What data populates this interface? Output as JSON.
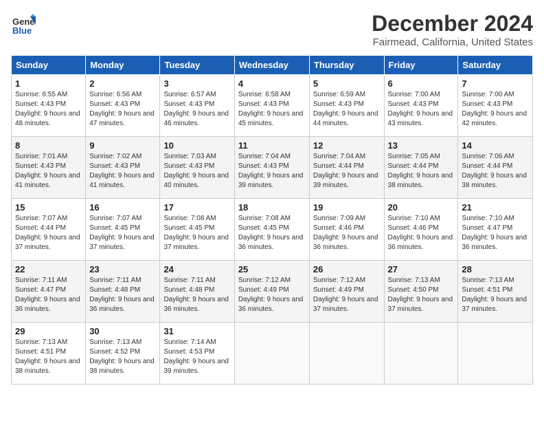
{
  "logo": {
    "line1": "General",
    "line2": "Blue"
  },
  "title": "December 2024",
  "subtitle": "Fairmead, California, United States",
  "weekdays": [
    "Sunday",
    "Monday",
    "Tuesday",
    "Wednesday",
    "Thursday",
    "Friday",
    "Saturday"
  ],
  "weeks": [
    [
      {
        "day": "1",
        "sunrise": "6:55 AM",
        "sunset": "4:43 PM",
        "daylight": "9 hours and 48 minutes."
      },
      {
        "day": "2",
        "sunrise": "6:56 AM",
        "sunset": "4:43 PM",
        "daylight": "9 hours and 47 minutes."
      },
      {
        "day": "3",
        "sunrise": "6:57 AM",
        "sunset": "4:43 PM",
        "daylight": "9 hours and 46 minutes."
      },
      {
        "day": "4",
        "sunrise": "6:58 AM",
        "sunset": "4:43 PM",
        "daylight": "9 hours and 45 minutes."
      },
      {
        "day": "5",
        "sunrise": "6:59 AM",
        "sunset": "4:43 PM",
        "daylight": "9 hours and 44 minutes."
      },
      {
        "day": "6",
        "sunrise": "7:00 AM",
        "sunset": "4:43 PM",
        "daylight": "9 hours and 43 minutes."
      },
      {
        "day": "7",
        "sunrise": "7:00 AM",
        "sunset": "4:43 PM",
        "daylight": "9 hours and 42 minutes."
      }
    ],
    [
      {
        "day": "8",
        "sunrise": "7:01 AM",
        "sunset": "4:43 PM",
        "daylight": "9 hours and 41 minutes."
      },
      {
        "day": "9",
        "sunrise": "7:02 AM",
        "sunset": "4:43 PM",
        "daylight": "9 hours and 41 minutes."
      },
      {
        "day": "10",
        "sunrise": "7:03 AM",
        "sunset": "4:43 PM",
        "daylight": "9 hours and 40 minutes."
      },
      {
        "day": "11",
        "sunrise": "7:04 AM",
        "sunset": "4:43 PM",
        "daylight": "9 hours and 39 minutes."
      },
      {
        "day": "12",
        "sunrise": "7:04 AM",
        "sunset": "4:44 PM",
        "daylight": "9 hours and 39 minutes."
      },
      {
        "day": "13",
        "sunrise": "7:05 AM",
        "sunset": "4:44 PM",
        "daylight": "9 hours and 38 minutes."
      },
      {
        "day": "14",
        "sunrise": "7:06 AM",
        "sunset": "4:44 PM",
        "daylight": "9 hours and 38 minutes."
      }
    ],
    [
      {
        "day": "15",
        "sunrise": "7:07 AM",
        "sunset": "4:44 PM",
        "daylight": "9 hours and 37 minutes."
      },
      {
        "day": "16",
        "sunrise": "7:07 AM",
        "sunset": "4:45 PM",
        "daylight": "9 hours and 37 minutes."
      },
      {
        "day": "17",
        "sunrise": "7:08 AM",
        "sunset": "4:45 PM",
        "daylight": "9 hours and 37 minutes."
      },
      {
        "day": "18",
        "sunrise": "7:08 AM",
        "sunset": "4:45 PM",
        "daylight": "9 hours and 36 minutes."
      },
      {
        "day": "19",
        "sunrise": "7:09 AM",
        "sunset": "4:46 PM",
        "daylight": "9 hours and 36 minutes."
      },
      {
        "day": "20",
        "sunrise": "7:10 AM",
        "sunset": "4:46 PM",
        "daylight": "9 hours and 36 minutes."
      },
      {
        "day": "21",
        "sunrise": "7:10 AM",
        "sunset": "4:47 PM",
        "daylight": "9 hours and 36 minutes."
      }
    ],
    [
      {
        "day": "22",
        "sunrise": "7:11 AM",
        "sunset": "4:47 PM",
        "daylight": "9 hours and 36 minutes."
      },
      {
        "day": "23",
        "sunrise": "7:11 AM",
        "sunset": "4:48 PM",
        "daylight": "9 hours and 36 minutes."
      },
      {
        "day": "24",
        "sunrise": "7:11 AM",
        "sunset": "4:48 PM",
        "daylight": "9 hours and 36 minutes."
      },
      {
        "day": "25",
        "sunrise": "7:12 AM",
        "sunset": "4:49 PM",
        "daylight": "9 hours and 36 minutes."
      },
      {
        "day": "26",
        "sunrise": "7:12 AM",
        "sunset": "4:49 PM",
        "daylight": "9 hours and 37 minutes."
      },
      {
        "day": "27",
        "sunrise": "7:13 AM",
        "sunset": "4:50 PM",
        "daylight": "9 hours and 37 minutes."
      },
      {
        "day": "28",
        "sunrise": "7:13 AM",
        "sunset": "4:51 PM",
        "daylight": "9 hours and 37 minutes."
      }
    ],
    [
      {
        "day": "29",
        "sunrise": "7:13 AM",
        "sunset": "4:51 PM",
        "daylight": "9 hours and 38 minutes."
      },
      {
        "day": "30",
        "sunrise": "7:13 AM",
        "sunset": "4:52 PM",
        "daylight": "9 hours and 38 minutes."
      },
      {
        "day": "31",
        "sunrise": "7:14 AM",
        "sunset": "4:53 PM",
        "daylight": "9 hours and 39 minutes."
      },
      null,
      null,
      null,
      null
    ]
  ]
}
